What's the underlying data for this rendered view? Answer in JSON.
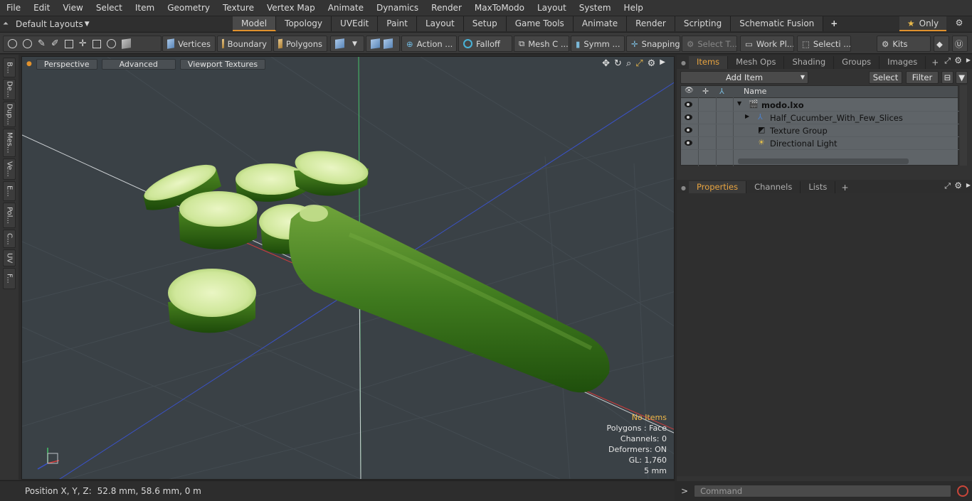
{
  "menu": [
    "File",
    "Edit",
    "View",
    "Select",
    "Item",
    "Geometry",
    "Texture",
    "Vertex Map",
    "Animate",
    "Dynamics",
    "Render",
    "MaxToModo",
    "Layout",
    "System",
    "Help"
  ],
  "layout_selector": "Default Layouts",
  "layout_tabs": [
    "Model",
    "Topology",
    "UVEdit",
    "Paint",
    "Layout",
    "Setup",
    "Game Tools",
    "Animate",
    "Render",
    "Scripting",
    "Schematic Fusion"
  ],
  "active_layout_tab": "Model",
  "only_label": "Only",
  "toolbar": {
    "vertices": "Vertices",
    "boundary": "Boundary",
    "polygons": "Polygons",
    "action": "Action ...",
    "falloff": "Falloff",
    "mesh_c": "Mesh C ...",
    "symm": "Symm ...",
    "snapping": "Snapping",
    "select_t": "Select T...",
    "work_pl": "Work Pl...",
    "selecti": "Selecti ...",
    "kits": "Kits"
  },
  "left_tabs": [
    "B...",
    "De...",
    "Dup...",
    "Mes...",
    "Ve...",
    "E...",
    "Pol...",
    "C...",
    "UV",
    "F..."
  ],
  "viewport": {
    "view_mode": "Perspective",
    "shading": "Advanced",
    "textures": "Viewport Textures",
    "info": {
      "selection": "No Items",
      "polygons": "Polygons : Face",
      "channels": "Channels: 0",
      "deformers": "Deformers: ON",
      "gl": "GL: 1,760",
      "grid": "5 mm"
    }
  },
  "status": {
    "label": "Position X, Y, Z:",
    "value": "52.8 mm, 58.6 mm, 0 m"
  },
  "items_panel": {
    "tabs": [
      "Items",
      "Mesh Ops",
      "Shading",
      "Groups",
      "Images"
    ],
    "active_tab": "Items",
    "add_item": "Add Item",
    "select": "Select",
    "filter": "Filter",
    "name_header": "Name",
    "tree": [
      {
        "name": "modo.lxo",
        "depth": 0,
        "bold": true
      },
      {
        "name": "Half_Cucumber_With_Few_Slices",
        "depth": 1,
        "bold": false
      },
      {
        "name": "Texture Group",
        "depth": 1,
        "bold": false
      },
      {
        "name": "Directional Light",
        "depth": 1,
        "bold": false
      }
    ]
  },
  "properties_panel": {
    "tabs": [
      "Properties",
      "Channels",
      "Lists"
    ],
    "active_tab": "Properties"
  },
  "command": {
    "prompt": ">",
    "placeholder": "Command"
  },
  "colors": {
    "accent": "#e0912d",
    "viewport_bg": "#3a4146",
    "cucumber_skin": "#3f7a1e",
    "cucumber_flesh": "#cfe79a"
  }
}
